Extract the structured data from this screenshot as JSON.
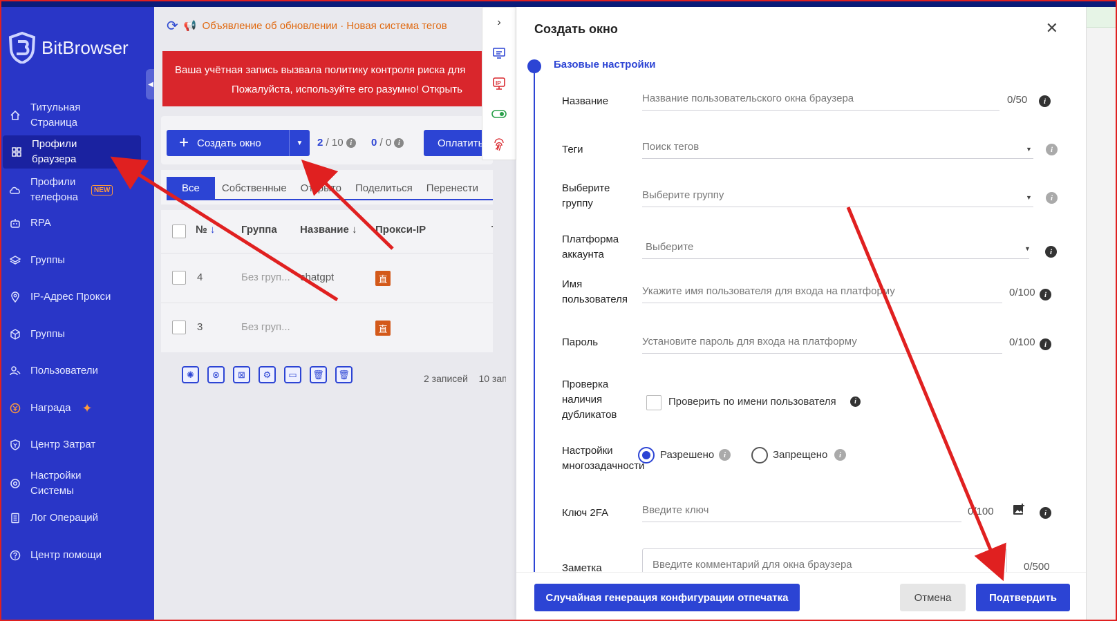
{
  "app": {
    "name": "BitBrowser"
  },
  "sidebar": {
    "items": [
      {
        "label": "Титульная Страница",
        "icon": "home-icon"
      },
      {
        "label": "Профили браузера",
        "icon": "grid-icon",
        "active": true
      },
      {
        "label": "Профили телефона",
        "icon": "cloud-icon",
        "badge": "NEW"
      },
      {
        "label": "RPA",
        "icon": "robot-icon"
      },
      {
        "label": "Группы",
        "icon": "layers-icon"
      },
      {
        "label": "IP-Адрес Прокси",
        "icon": "location-icon"
      },
      {
        "label": "Группы",
        "icon": "cube-icon"
      },
      {
        "label": "Пользователи",
        "icon": "users-icon"
      },
      {
        "label": "Награда",
        "icon": "coin-icon"
      },
      {
        "label": "Центр Затрат",
        "icon": "shield-icon"
      },
      {
        "label": "Настройки Системы",
        "icon": "gear-icon"
      },
      {
        "label": "Лог Операций",
        "icon": "log-icon"
      },
      {
        "label": "Центр помощи",
        "icon": "help-icon"
      }
    ]
  },
  "main": {
    "announcement": "Объявление об обновлении · Новая система тегов",
    "warning_line1": "Ваша учётная запись вызвала политику контроля риска для",
    "warning_line2": "Пожалуйста, используйте его разумно! Открыть",
    "create_button": "Создать окно",
    "counter1_value": "2",
    "counter1_total": "/ 10",
    "counter2_value": "0",
    "counter2_total": "/ 0",
    "pay_button": "Оплатить",
    "tabs": [
      "Все",
      "Собственные",
      "Открыто",
      "Поделиться",
      "Перенести"
    ],
    "columns": [
      "№",
      "Группа",
      "Название",
      "Прокси-IP",
      "Те"
    ],
    "rows": [
      {
        "num": "4",
        "group": "Без груп...",
        "name": "chatgpt",
        "proxy": "直"
      },
      {
        "num": "3",
        "group": "Без груп...",
        "name": "",
        "proxy": "直"
      }
    ],
    "records": "2 записей",
    "per_page": "10 зап"
  },
  "dialog": {
    "title": "Создать окно",
    "section": "Базовые настройки",
    "fields": {
      "name_label": "Название",
      "name_placeholder": "Название пользовательского окна браузера",
      "name_counter": "0/50",
      "tags_label": "Теги",
      "tags_placeholder": "Поиск тегов",
      "group_label": "Выберите группу",
      "group_placeholder": "Выберите группу",
      "platform_label": "Платформа аккаунта",
      "platform_placeholder": "Выберите",
      "username_label": "Имя пользователя",
      "username_placeholder": "Укажите имя пользователя для входа на платформу",
      "username_counter": "0/100",
      "password_label": "Пароль",
      "password_placeholder": "Установите пароль для входа на платформу",
      "password_counter": "0/100",
      "dup_label": "Проверка наличия дубликатов",
      "dup_option": "Проверить по имени пользователя",
      "multi_label": "Настройки многозадачности",
      "multi_allowed": "Разрешено",
      "multi_forbidden": "Запрещено",
      "twofa_label": "Ключ 2FA",
      "twofa_placeholder": "Введите ключ",
      "twofa_counter": "0/100",
      "note_label": "Заметка",
      "note_placeholder": "Введите комментарий для окна браузера",
      "note_counter": "0/500"
    },
    "buttons": {
      "random": "Случайная генерация конфигурации отпечатка",
      "cancel": "Отмена",
      "confirm": "Подтвердить"
    }
  },
  "colors": {
    "sidebar": "#2936c7",
    "accent": "#2c44d4",
    "warning": "#d9262c",
    "arrow": "#e02020"
  }
}
